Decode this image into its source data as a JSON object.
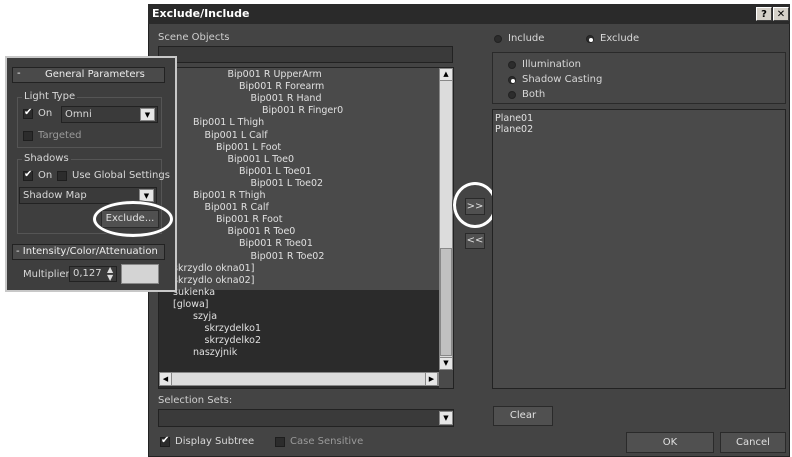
{
  "dialog": {
    "title": "Exclude/Include",
    "help_btn": "?",
    "close_btn": "✕",
    "scene_objects_label": "Scene Objects",
    "include_label": "Include",
    "exclude_label": "Exclude",
    "mode": "exclude",
    "illumination_label": "Illumination",
    "shadow_casting_label": "Shadow Casting",
    "both_label": "Both",
    "type_selected": "shadow_casting",
    "scene_items": [
      {
        "label": "Bip001 R UpperArm",
        "indent": 4
      },
      {
        "label": "Bip001 R Forearm",
        "indent": 5
      },
      {
        "label": "Bip001 R Hand",
        "indent": 6
      },
      {
        "label": "Bip001 R Finger0",
        "indent": 7
      },
      {
        "label": "Bip001 L Thigh",
        "indent": 1
      },
      {
        "label": "Bip001 L Calf",
        "indent": 2
      },
      {
        "label": "Bip001 L Foot",
        "indent": 3
      },
      {
        "label": "Bip001 L Toe0",
        "indent": 4
      },
      {
        "label": "Bip001 L Toe01",
        "indent": 5
      },
      {
        "label": "Bip001 L Toe02",
        "indent": 6
      },
      {
        "label": "Bip001 R Thigh",
        "indent": 1
      },
      {
        "label": "Bip001 R Calf",
        "indent": 2
      },
      {
        "label": "Bip001 R Foot",
        "indent": 3
      },
      {
        "label": "Bip001 R Toe0",
        "indent": 4
      },
      {
        "label": "Bip001 R Toe01",
        "indent": 5
      },
      {
        "label": "Bip001 R Toe02",
        "indent": 6
      },
      {
        "label": "skrzydlo okna01]",
        "indent": 0
      },
      {
        "label": "skrzydlo okna02]",
        "indent": 0
      },
      {
        "label": "sukienka",
        "indent": 0
      },
      {
        "label": "[glowa]",
        "indent": 0
      },
      {
        "label": "szyja",
        "indent": 1
      },
      {
        "label": "skrzydelko1",
        "indent": 2
      },
      {
        "label": "skrzydelko2",
        "indent": 2
      },
      {
        "label": "naszyjnik",
        "indent": 1
      }
    ],
    "move_right_btn": ">>",
    "move_left_btn": "<<",
    "excluded_items": [
      "Plane01",
      "Plane02"
    ],
    "selection_sets_label": "Selection Sets:",
    "clear_btn": "Clear",
    "display_subtree_label": "Display Subtree",
    "display_subtree_checked": true,
    "case_sensitive_label": "Case Sensitive",
    "case_sensitive_checked": false,
    "ok_btn": "OK",
    "cancel_btn": "Cancel"
  },
  "panel": {
    "general_params_title": "General Parameters",
    "collapse": "-",
    "light_type_label": "Light Type",
    "on_label": "On",
    "on_checked": true,
    "light_type_value": "Omni",
    "targeted_label": "Targeted",
    "shadows_label": "Shadows",
    "shadows_on_label": "On",
    "use_global_label": "Use Global Settings",
    "shadow_type_value": "Shadow Map",
    "exclude_btn": "Exclude...",
    "intensity_title": "- Intensity/Color/Attenuation",
    "multiplier_label": "Multiplier:",
    "multiplier_value": "0,127"
  }
}
